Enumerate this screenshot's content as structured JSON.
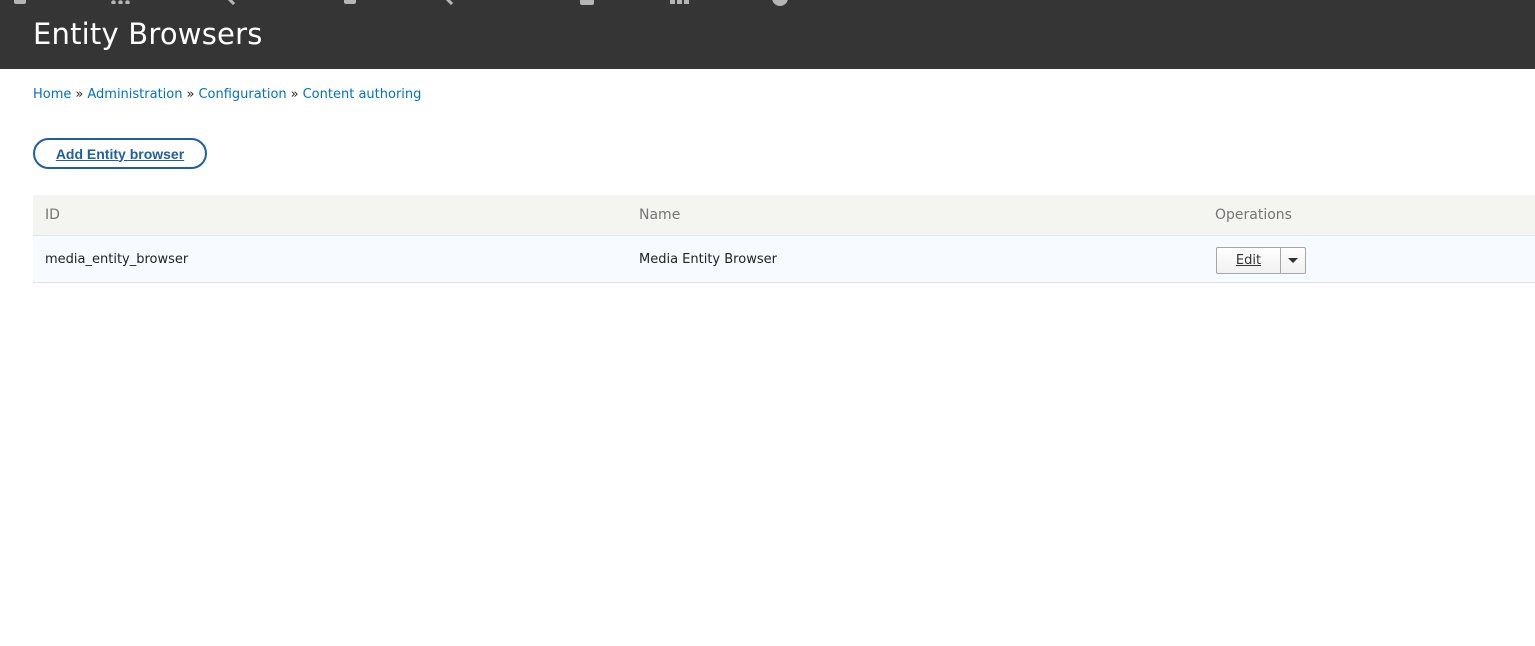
{
  "header": {
    "title": "Entity Browsers",
    "toolbar_icons": [
      "menu-icon",
      "dots-icon",
      "wrench-icon",
      "structure-icon",
      "wrench-icon",
      "person-icon",
      "bars-icon",
      "help-icon"
    ]
  },
  "breadcrumb": {
    "items": [
      "Home",
      "Administration",
      "Configuration",
      "Content authoring"
    ],
    "separator": "»"
  },
  "actions": {
    "add_label": "Add Entity browser"
  },
  "table": {
    "columns": [
      "ID",
      "Name",
      "Operations"
    ],
    "rows": [
      {
        "id": "media_entity_browser",
        "name": "Media Entity Browser",
        "operation": "Edit"
      }
    ]
  },
  "colors": {
    "header_bg": "#353535",
    "link": "#0074bd",
    "button_border": "#1e5fa0"
  }
}
